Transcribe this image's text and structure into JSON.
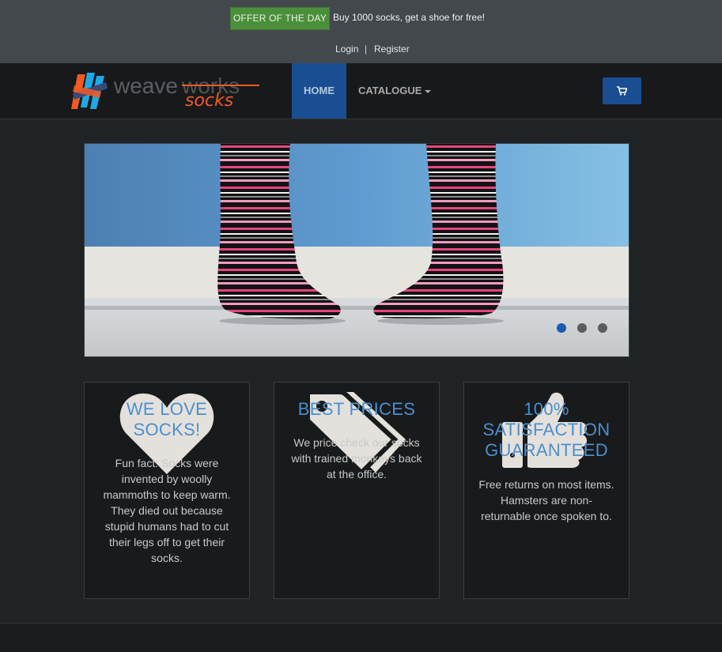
{
  "topbar": {
    "offer_label": "OFFER OF THE DAY",
    "offer_text": "Buy 1000 socks, get a shoe for free!",
    "login": "Login",
    "separator": "|",
    "register": "Register"
  },
  "navbar": {
    "logo_text_1": "weave",
    "logo_text_2": "works",
    "logo_text_3": "socks",
    "home": "HOME",
    "catalogue": "CATALOGUE",
    "cart_icon": "shopping-cart-icon"
  },
  "carousel": {
    "slide_count": 3,
    "active_slide": 1
  },
  "features": [
    {
      "icon": "heart-icon",
      "title_lines": [
        "WE LOVE",
        "SOCKS!"
      ],
      "text": "Fun fact: Socks were invented by woolly mammoths to keep warm. They died out because stupid humans had to cut their legs off to get their socks."
    },
    {
      "icon": "tags-icon",
      "title_lines": [
        "BEST PRICES"
      ],
      "text": "We price check our socks with trained monkeys back at the office."
    },
    {
      "icon": "thumbs-up-icon",
      "title_lines": [
        "100%",
        "SATISFACTION",
        "GUARANTEED"
      ],
      "text": "Free returns on most items. Hamsters are non-returnable once spoken to."
    }
  ],
  "colors": {
    "accent_blue": "#1a4e93",
    "offer_green": "#4b8f3a",
    "title_blue": "#4a90d0",
    "logo_orange": "#f15a24"
  }
}
